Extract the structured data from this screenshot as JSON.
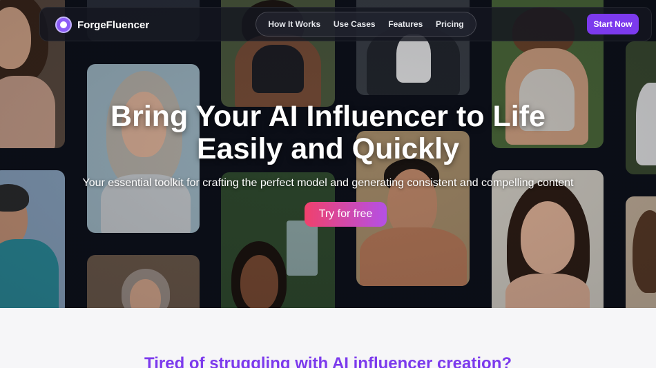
{
  "brand": {
    "name": "ForgeFluencer",
    "accent": "#7c3aed"
  },
  "nav": {
    "links": [
      "How It Works",
      "Use Cases",
      "Features",
      "Pricing"
    ],
    "cta": "Start Now"
  },
  "hero": {
    "headline_line1": "Bring Your AI Influencer to Life",
    "headline_line2": "Easily and Quickly",
    "subheadline": "Your essential toolkit for crafting the perfect model and generating consistent and compelling content",
    "cta": "Try for free"
  },
  "section": {
    "title": "Tired of struggling with AI influencer creation?"
  },
  "icons": {
    "logo": "avatar-logo-icon"
  }
}
